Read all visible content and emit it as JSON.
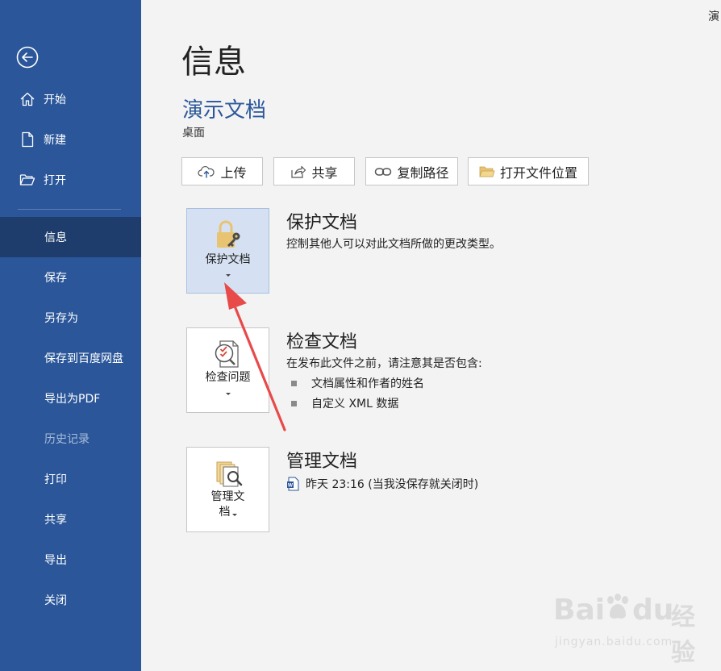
{
  "corner_text": "演",
  "sidebar": {
    "items": [
      {
        "label": "开始",
        "icon": "home-icon"
      },
      {
        "label": "新建",
        "icon": "new-document-icon"
      },
      {
        "label": "打开",
        "icon": "folder-open-icon"
      },
      {
        "label": "信息",
        "active": true
      },
      {
        "label": "保存"
      },
      {
        "label": "另存为"
      },
      {
        "label": "保存到百度网盘"
      },
      {
        "label": "导出为PDF"
      },
      {
        "label": "历史记录",
        "disabled": true
      },
      {
        "label": "打印"
      },
      {
        "label": "共享"
      },
      {
        "label": "导出"
      },
      {
        "label": "关闭"
      }
    ]
  },
  "main": {
    "title": "信息",
    "document_name": "演示文档",
    "location": "桌面",
    "actions": [
      {
        "label": "上传",
        "icon": "upload-icon"
      },
      {
        "label": "共享",
        "icon": "share-icon"
      },
      {
        "label": "复制路径",
        "icon": "link-icon"
      },
      {
        "label": "打开文件位置",
        "icon": "folder-icon"
      }
    ],
    "protect": {
      "tile_label": "保护文档",
      "title": "保护文档",
      "description": "控制其他人可以对此文档所做的更改类型。"
    },
    "inspect": {
      "tile_label": "检查问题",
      "title": "检查文档",
      "description": "在发布此文件之前，请注意其是否包含:",
      "bullets": [
        "文档属性和作者的姓名",
        "自定义 XML 数据"
      ]
    },
    "manage": {
      "tile_label_line1": "管理文",
      "tile_label_line2": "档",
      "title": "管理文档",
      "version": "昨天 23:16 (当我没保存就关闭时)"
    }
  },
  "watermark": {
    "brand": "Bai",
    "brand2": "du",
    "product": "经验",
    "url": "jingyan.baidu.com"
  },
  "colors": {
    "sidebar": "#2b579a",
    "sidebar_active": "#1e3d6d",
    "accent": "#2b579a",
    "arrow": "#e84a4a",
    "selected_tile": "#d5e1f2"
  }
}
